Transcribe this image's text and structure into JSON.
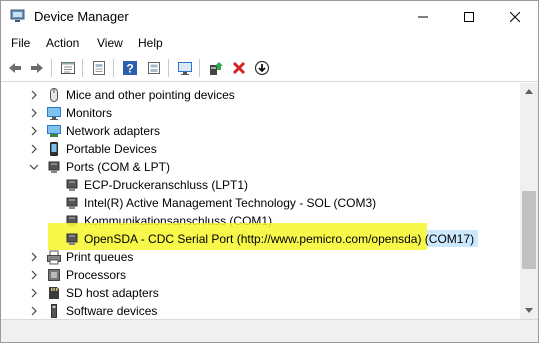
{
  "window": {
    "title": "Device Manager"
  },
  "menu": {
    "items": [
      "File",
      "Action",
      "View",
      "Help"
    ]
  },
  "toolbar": {
    "buttons": [
      "back-icon",
      "forward-icon",
      "properties-icon",
      "show-hidden-icon",
      "help-icon",
      "driver-icon",
      "monitor-icon",
      "update-driver-icon",
      "uninstall-icon",
      "download-icon"
    ]
  },
  "tree": {
    "categories": [
      {
        "label": "Mice and other pointing devices",
        "icon": "mouse-icon",
        "expanded": false
      },
      {
        "label": "Monitors",
        "icon": "monitor-icon",
        "expanded": false
      },
      {
        "label": "Network adapters",
        "icon": "network-icon",
        "expanded": false
      },
      {
        "label": "Portable Devices",
        "icon": "portable-device-icon",
        "expanded": false
      },
      {
        "label": "Ports (COM & LPT)",
        "icon": "port-icon",
        "expanded": true
      },
      {
        "label": "Print queues",
        "icon": "printer-icon",
        "expanded": false
      },
      {
        "label": "Processors",
        "icon": "processor-icon",
        "expanded": false
      },
      {
        "label": "SD host adapters",
        "icon": "sd-card-icon",
        "expanded": false
      },
      {
        "label": "Software devices",
        "icon": "software-device-icon",
        "expanded": false
      }
    ],
    "ports": [
      {
        "label": "ECP-Druckeranschluss (LPT1)"
      },
      {
        "label": "Intel(R) Active Management Technology - SOL (COM3)"
      },
      {
        "label": "Kommunikationsanschluss (COM1)"
      },
      {
        "label": "OpenSDA - CDC Serial Port (http://www.pemicro.com/opensda)",
        "suffix": " (COM17)",
        "selected": true
      }
    ]
  },
  "colors": {
    "highlight": "#f7f72c",
    "selection": "#cce8ff",
    "close_red": "#e81123",
    "icon_blue": "#2b78c5"
  }
}
